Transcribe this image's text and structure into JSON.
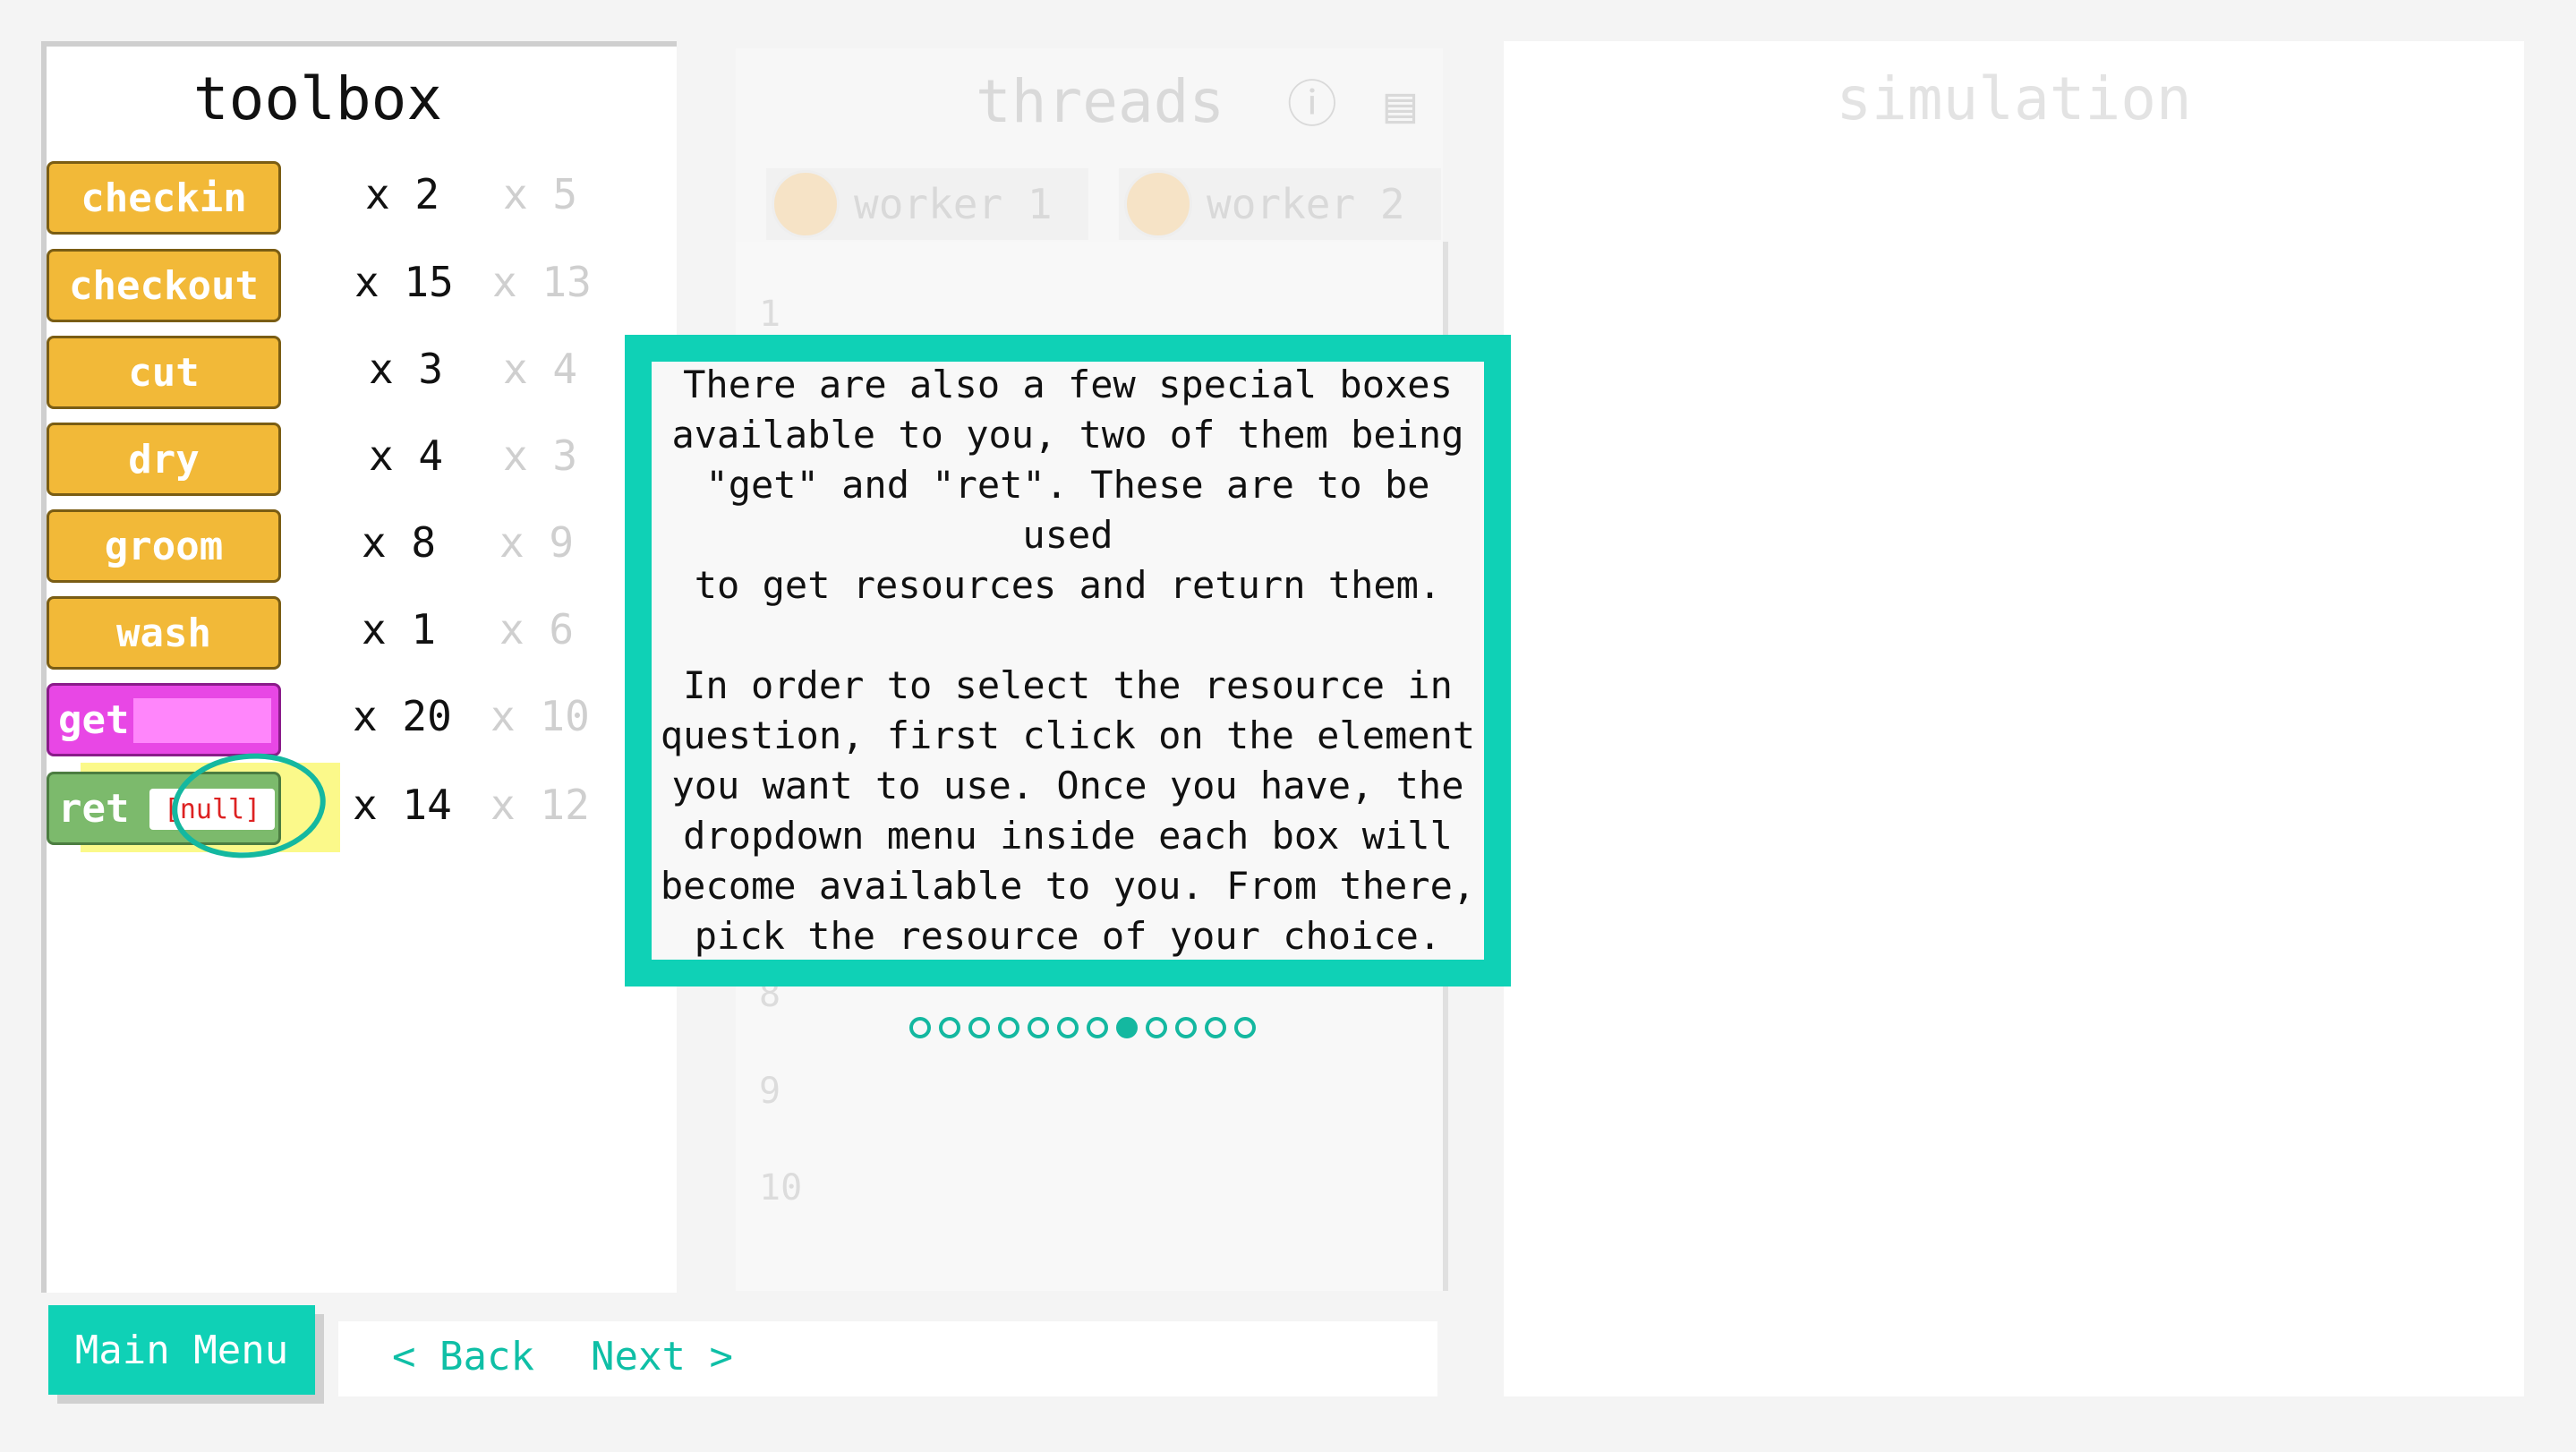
{
  "toolbox": {
    "title": "toolbox",
    "items": [
      {
        "label": "checkin",
        "have": "x 2",
        "need": "x 5",
        "kind": "orange"
      },
      {
        "label": "checkout",
        "have": "x 15",
        "need": "x 13",
        "kind": "orange"
      },
      {
        "label": "cut",
        "have": "x 3",
        "need": "x 4",
        "kind": "orange"
      },
      {
        "label": "dry",
        "have": "x 4",
        "need": "x 3",
        "kind": "orange"
      },
      {
        "label": "groom",
        "have": "x 8",
        "need": "x 9",
        "kind": "orange"
      },
      {
        "label": "wash",
        "have": "x 1",
        "need": "x 6",
        "kind": "orange"
      },
      {
        "label": "get",
        "have": "x 20",
        "need": "x 10",
        "kind": "pink"
      },
      {
        "label": "ret",
        "slot": "[null]",
        "have": "x 14",
        "need": "x 12",
        "kind": "green"
      }
    ]
  },
  "threads": {
    "title": "threads",
    "info_icon": "info-icon",
    "clipboard_icon": "clipboard-icon",
    "workers": [
      "worker 1",
      "worker 2"
    ],
    "line_numbers": [
      "1",
      "8",
      "9",
      "10"
    ]
  },
  "simulation": {
    "title": "simulation"
  },
  "tutorial": {
    "paragraph1": "There are also a few special boxes\navailable to you, two of them being\n\"get\" and \"ret\". These are to be used\nto get resources and return them.",
    "paragraph2": "In order to select the resource in\nquestion, first click on the element\nyou want to use. Once you have, the\ndropdown menu inside each box  will\nbecome available to you. From there,\npick the resource of your choice.",
    "step_count": 12,
    "current_step": 8
  },
  "nav": {
    "main_menu": "Main Menu",
    "back": "< Back",
    "next": "Next >"
  },
  "colors": {
    "accent": "#0fd1b6",
    "tool_orange": "#f2b938",
    "tool_pink": "#e847e5",
    "tool_green": "#7cba6c",
    "highlight": "#fbf98a"
  }
}
